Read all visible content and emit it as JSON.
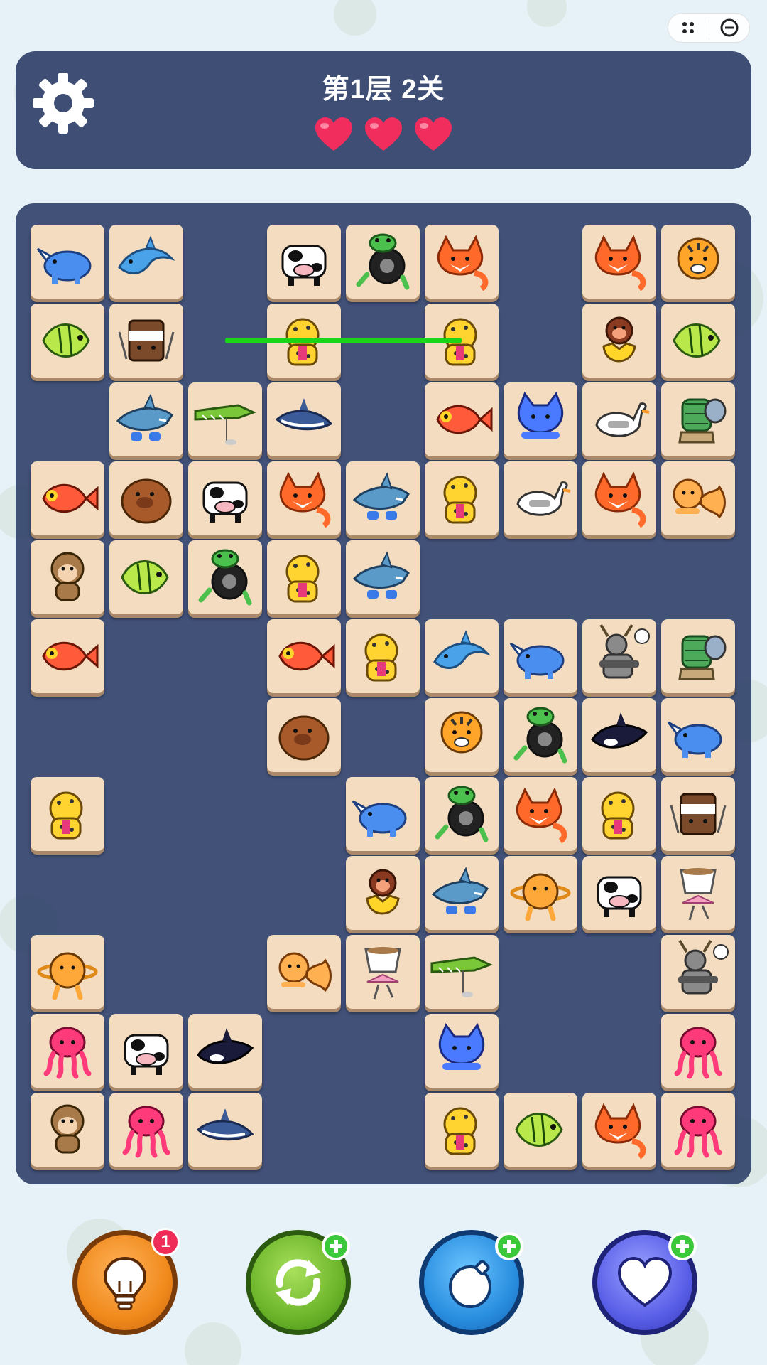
{
  "app": {
    "title_bar_buttons": [
      "more-icon",
      "close-icon"
    ]
  },
  "header": {
    "level_title": "第1层 2关",
    "lives": 3,
    "life_icon": "heart-icon",
    "settings_icon": "gear-icon"
  },
  "colors": {
    "header_bg": "#3f4e74",
    "board_bg": "#34456e",
    "tile_bg": "#f3dcbf",
    "link_line": "#19d619",
    "heart": "#f02d5c"
  },
  "board": {
    "columns": 9,
    "rows": 12,
    "selected_link": {
      "from": [
        2,
        1
      ],
      "to": [
        5,
        1
      ]
    },
    "tiles": [
      {
        "r": 0,
        "c": 0,
        "t": "rhino"
      },
      {
        "r": 0,
        "c": 1,
        "t": "dolphin"
      },
      {
        "r": 0,
        "c": 3,
        "t": "cow"
      },
      {
        "r": 0,
        "c": 4,
        "t": "frog"
      },
      {
        "r": 0,
        "c": 5,
        "t": "fox"
      },
      {
        "r": 0,
        "c": 7,
        "t": "fox"
      },
      {
        "r": 0,
        "c": 8,
        "t": "tiger"
      },
      {
        "r": 1,
        "c": 0,
        "t": "tropical-fish"
      },
      {
        "r": 1,
        "c": 1,
        "t": "coffee-cup"
      },
      {
        "r": 1,
        "c": 3,
        "t": "leopard"
      },
      {
        "r": 1,
        "c": 5,
        "t": "leopard"
      },
      {
        "r": 1,
        "c": 7,
        "t": "monkey-banana"
      },
      {
        "r": 1,
        "c": 8,
        "t": "tropical-fish"
      },
      {
        "r": 2,
        "c": 1,
        "t": "shark"
      },
      {
        "r": 2,
        "c": 2,
        "t": "crocodile"
      },
      {
        "r": 2,
        "c": 3,
        "t": "small-shark"
      },
      {
        "r": 2,
        "c": 5,
        "t": "red-fish"
      },
      {
        "r": 2,
        "c": 6,
        "t": "cat"
      },
      {
        "r": 2,
        "c": 7,
        "t": "goose"
      },
      {
        "r": 2,
        "c": 8,
        "t": "elephant"
      },
      {
        "r": 3,
        "c": 0,
        "t": "red-fish"
      },
      {
        "r": 3,
        "c": 1,
        "t": "capybara"
      },
      {
        "r": 3,
        "c": 2,
        "t": "cow"
      },
      {
        "r": 3,
        "c": 3,
        "t": "fox"
      },
      {
        "r": 3,
        "c": 4,
        "t": "shark"
      },
      {
        "r": 3,
        "c": 5,
        "t": "leopard"
      },
      {
        "r": 3,
        "c": 6,
        "t": "goose"
      },
      {
        "r": 3,
        "c": 7,
        "t": "fox"
      },
      {
        "r": 3,
        "c": 8,
        "t": "catfish"
      },
      {
        "r": 4,
        "c": 0,
        "t": "monkey"
      },
      {
        "r": 4,
        "c": 1,
        "t": "tropical-fish"
      },
      {
        "r": 4,
        "c": 2,
        "t": "frog"
      },
      {
        "r": 4,
        "c": 3,
        "t": "leopard"
      },
      {
        "r": 4,
        "c": 4,
        "t": "shark"
      },
      {
        "r": 5,
        "c": 0,
        "t": "red-fish"
      },
      {
        "r": 5,
        "c": 3,
        "t": "red-fish"
      },
      {
        "r": 5,
        "c": 4,
        "t": "leopard"
      },
      {
        "r": 5,
        "c": 5,
        "t": "dolphin"
      },
      {
        "r": 5,
        "c": 6,
        "t": "rhino"
      },
      {
        "r": 5,
        "c": 7,
        "t": "deer"
      },
      {
        "r": 5,
        "c": 8,
        "t": "elephant"
      },
      {
        "r": 6,
        "c": 3,
        "t": "capybara"
      },
      {
        "r": 6,
        "c": 5,
        "t": "tiger"
      },
      {
        "r": 6,
        "c": 6,
        "t": "frog"
      },
      {
        "r": 6,
        "c": 7,
        "t": "orca"
      },
      {
        "r": 6,
        "c": 8,
        "t": "rhino"
      },
      {
        "r": 7,
        "c": 0,
        "t": "leopard"
      },
      {
        "r": 7,
        "c": 4,
        "t": "rhino"
      },
      {
        "r": 7,
        "c": 5,
        "t": "frog"
      },
      {
        "r": 7,
        "c": 6,
        "t": "fox"
      },
      {
        "r": 7,
        "c": 7,
        "t": "leopard"
      },
      {
        "r": 7,
        "c": 8,
        "t": "coffee-cup"
      },
      {
        "r": 8,
        "c": 4,
        "t": "monkey-banana"
      },
      {
        "r": 8,
        "c": 5,
        "t": "shark"
      },
      {
        "r": 8,
        "c": 6,
        "t": "cow-planet"
      },
      {
        "r": 8,
        "c": 7,
        "t": "cow"
      },
      {
        "r": 8,
        "c": 8,
        "t": "ballerina-cup"
      },
      {
        "r": 9,
        "c": 0,
        "t": "cow-planet"
      },
      {
        "r": 9,
        "c": 3,
        "t": "catfish"
      },
      {
        "r": 9,
        "c": 4,
        "t": "ballerina-cup"
      },
      {
        "r": 9,
        "c": 5,
        "t": "crocodile"
      },
      {
        "r": 9,
        "c": 8,
        "t": "deer"
      },
      {
        "r": 10,
        "c": 0,
        "t": "octopus"
      },
      {
        "r": 10,
        "c": 1,
        "t": "cow"
      },
      {
        "r": 10,
        "c": 2,
        "t": "orca"
      },
      {
        "r": 10,
        "c": 5,
        "t": "cat"
      },
      {
        "r": 10,
        "c": 8,
        "t": "octopus"
      },
      {
        "r": 11,
        "c": 0,
        "t": "monkey"
      },
      {
        "r": 11,
        "c": 1,
        "t": "octopus"
      },
      {
        "r": 11,
        "c": 2,
        "t": "small-shark"
      },
      {
        "r": 11,
        "c": 5,
        "t": "leopard"
      },
      {
        "r": 11,
        "c": 6,
        "t": "tropical-fish"
      },
      {
        "r": 11,
        "c": 7,
        "t": "fox"
      },
      {
        "r": 11,
        "c": 8,
        "t": "octopus"
      }
    ]
  },
  "tools": [
    {
      "name": "hint-button",
      "icon": "lightbulb-icon",
      "badge": "1"
    },
    {
      "name": "shuffle-button",
      "icon": "shuffle-icon",
      "plus": true
    },
    {
      "name": "bomb-button",
      "icon": "bomb-icon",
      "plus": true
    },
    {
      "name": "life-button",
      "icon": "heart-icon",
      "plus": true
    }
  ]
}
